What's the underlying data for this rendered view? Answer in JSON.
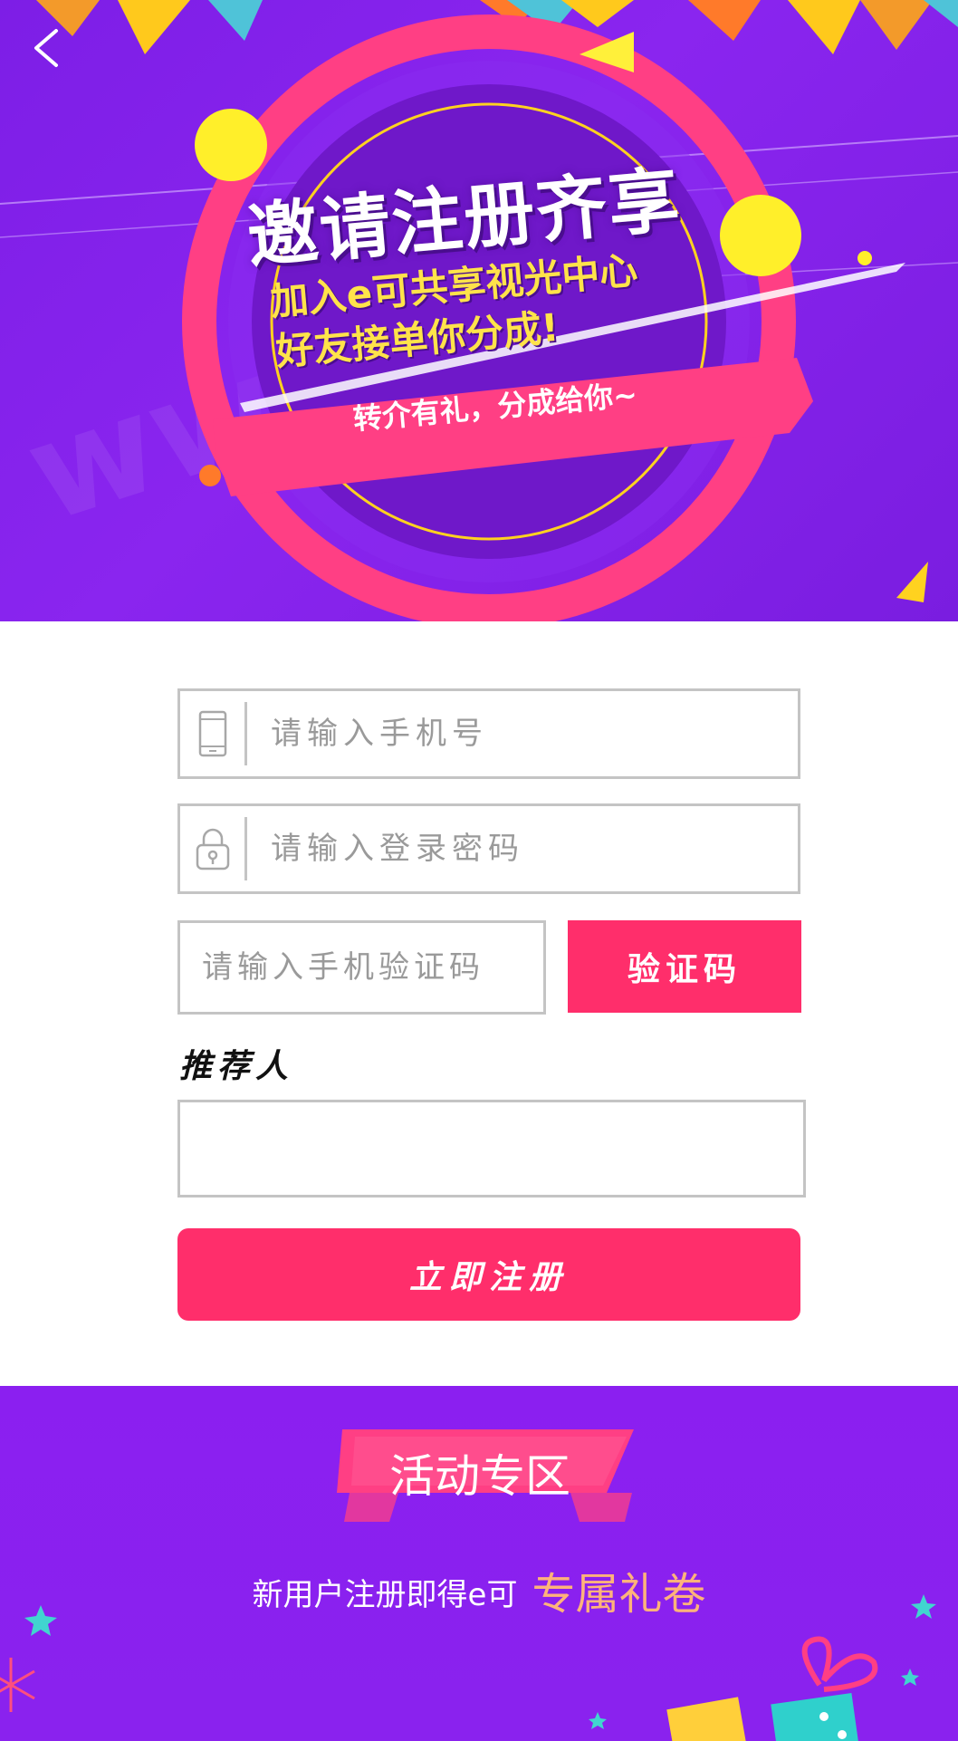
{
  "hero": {
    "title": "邀请注册齐享",
    "subtitle_line1": "加入e可共享视光中心",
    "subtitle_line2": "好友接单你分成!",
    "ribbon": "转介有礼，分成给你~",
    "watermark": "www.wsd"
  },
  "form": {
    "phone_placeholder": "请输入手机号",
    "password_placeholder": "请输入登录密码",
    "code_placeholder": "请输入手机验证码",
    "code_button": "验证码",
    "referrer_label": "推荐人",
    "referrer_value": "",
    "register_button": "立即注册"
  },
  "activity": {
    "title": "活动专区",
    "desc_plain": "新用户注册即得e可",
    "desc_highlight": "专属礼卷"
  },
  "colors": {
    "accent": "#ff2e6b",
    "purple": "#8a22ee",
    "highlight": "#ffb37a"
  }
}
